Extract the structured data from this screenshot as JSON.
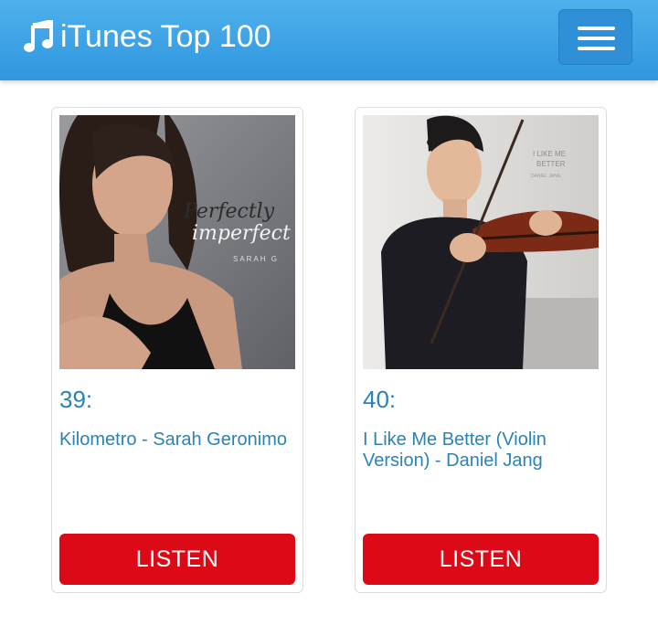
{
  "navbar": {
    "brand_icon": "music-note-icon",
    "brand_title": "iTunes Top 100",
    "menu_icon": "hamburger-menu-icon",
    "color": "#3aa2e6"
  },
  "songs": [
    {
      "rank": "39:",
      "title": "Kilometro - Sarah Geronimo",
      "listen_label": "LISTEN",
      "cover_text_line1": "Perfectly",
      "cover_text_line2": "imperfect",
      "cover_artist": "SARAH G"
    },
    {
      "rank": "40:",
      "title": "I Like Me Better (Violin Version) - Daniel Jang",
      "listen_label": "LISTEN",
      "cover_text_line1": "I LIKE ME",
      "cover_text_line2": "BETTER",
      "cover_artist": "DANIEL JANG"
    }
  ],
  "colors": {
    "accent": "#2b82b6",
    "listen_button": "#dc0a17"
  }
}
